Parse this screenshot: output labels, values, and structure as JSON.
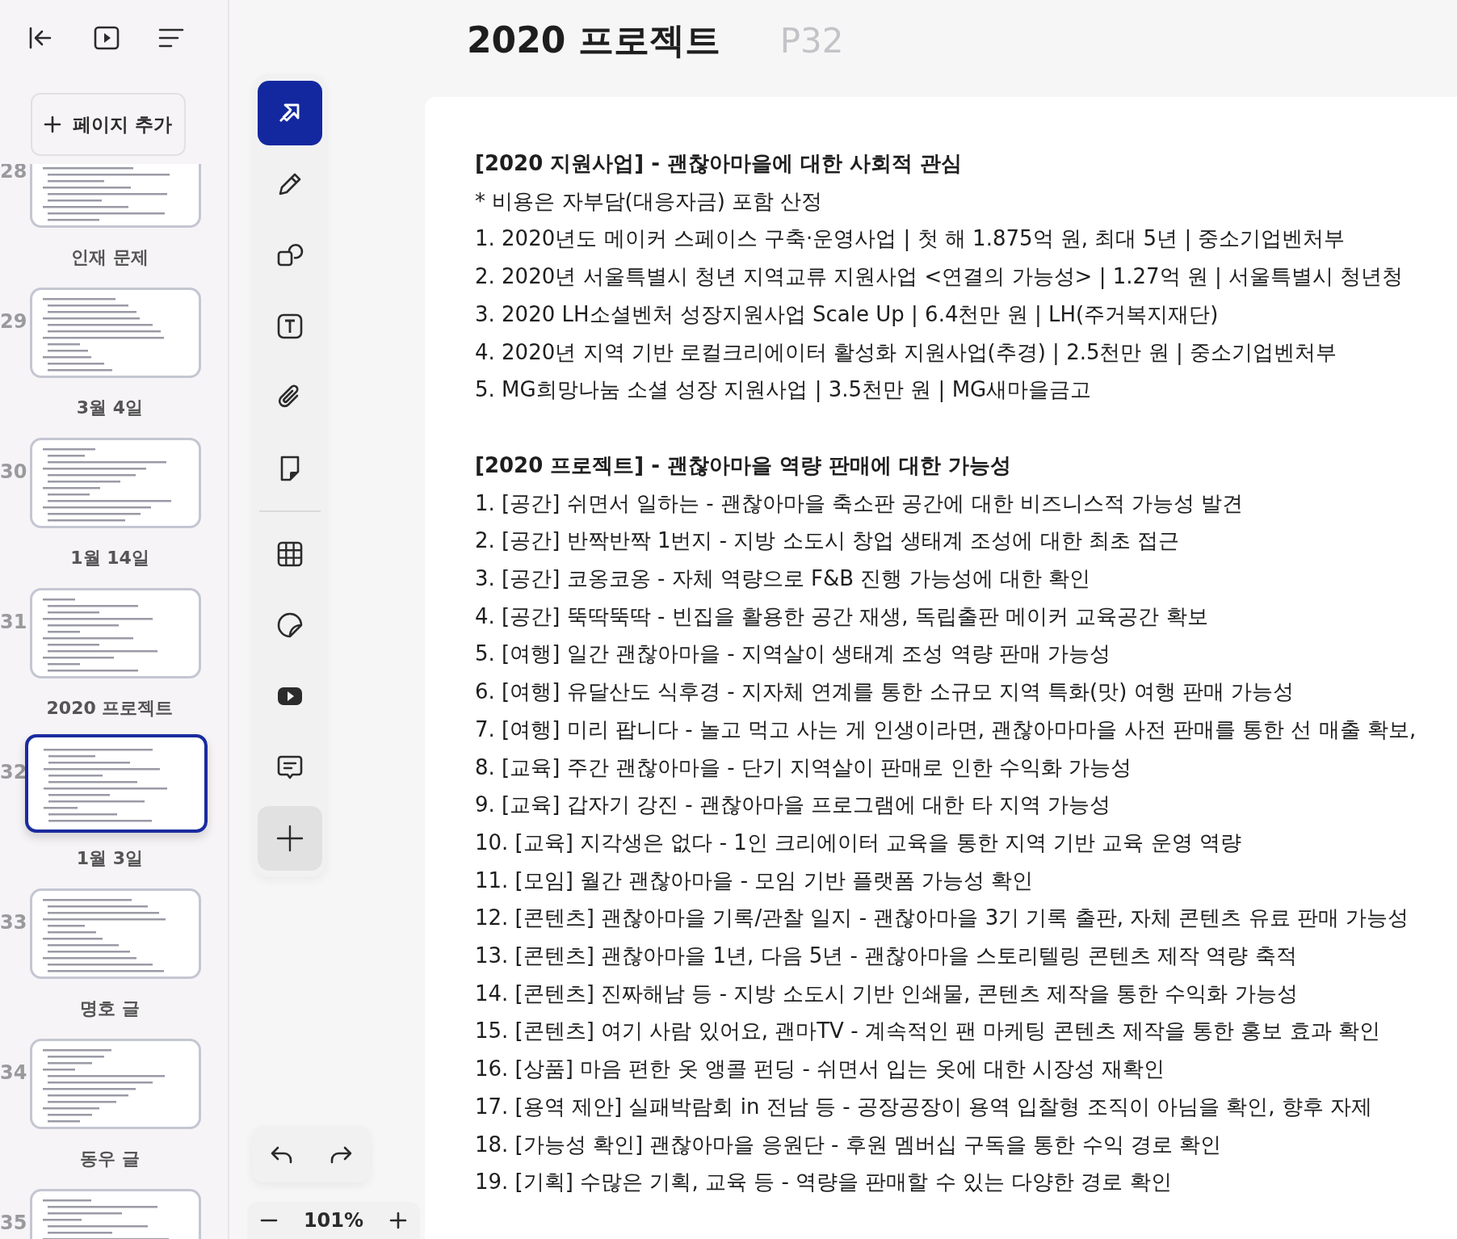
{
  "sidebar": {
    "add_page_button": {
      "label": "페이지 추가"
    },
    "pages": [
      {
        "number": "28",
        "selected": false
      },
      {
        "label": "인재 문제",
        "number": "29",
        "selected": false
      },
      {
        "label": "3월 4일",
        "number": "30",
        "selected": false
      },
      {
        "label": "1월 14일",
        "number": "31",
        "selected": false
      },
      {
        "label": "2020 프로젝트",
        "number": "32",
        "selected": true
      },
      {
        "label": "1월 3일",
        "number": "33",
        "selected": false
      },
      {
        "label": "명호 글",
        "number": "34",
        "selected": false
      },
      {
        "label": "동우 글",
        "number": "35",
        "selected": false
      }
    ]
  },
  "tools": [
    {
      "kind": "select",
      "selected": true
    },
    {
      "kind": "pen",
      "selected": false
    },
    {
      "kind": "shapes",
      "selected": false
    },
    {
      "kind": "text",
      "selected": false
    },
    {
      "kind": "attach",
      "selected": false
    },
    {
      "kind": "note",
      "selected": false
    },
    {
      "kind": "divider"
    },
    {
      "kind": "table",
      "selected": false
    },
    {
      "kind": "sticker",
      "selected": false
    },
    {
      "kind": "video",
      "selected": false
    },
    {
      "kind": "comment",
      "selected": false
    },
    {
      "kind": "add",
      "selected": false
    }
  ],
  "zoom": {
    "value": "101%"
  },
  "document": {
    "title": "2020 프로젝트",
    "page": "P32",
    "sections": [
      {
        "heading": "[2020 지원사업] - 괜찮아마을에 대한 사회적 관심",
        "lines": [
          "* 비용은 자부담(대응자금) 포함 산정",
          "1. 2020년도 메이커 스페이스 구축·운영사업 | 첫 해 1.875억 원, 최대 5년 | 중소기업벤처부",
          "2. 2020년 서울특별시 청년 지역교류 지원사업 <연결의 가능성> | 1.27억 원 | 서울특별시 청년청",
          "3. 2020 LH소셜벤처 성장지원사업 Scale Up | 6.4천만 원 | LH(주거복지재단)",
          "4. 2020년 지역 기반 로컬크리에이터 활성화 지원사업(추경) | 2.5천만 원 | 중소기업벤처부",
          "5. MG희망나눔 소셜 성장 지원사업 | 3.5천만 원 | MG새마을금고"
        ]
      },
      {
        "heading": "[2020 프로젝트] - 괜찮아마을 역량 판매에 대한 가능성",
        "lines": [
          "1. [공간] 쉬면서 일하는 - 괜찮아마을 축소판 공간에 대한 비즈니스적 가능성 발견",
          "2. [공간] 반짝반짝 1번지 - 지방 소도시 창업 생태계 조성에 대한 최초 접근",
          "3. [공간] 코옹코옹 - 자체 역량으로 F&B 진행 가능성에 대한 확인",
          "4. [공간] 뚝딱뚝딱 - 빈집을 활용한 공간 재생, 독립출판 메이커 교육공간 확보",
          "5. [여행] 일간 괜찮아마을 - 지역살이 생태계 조성 역량 판매 가능성",
          "6. [여행] 유달산도 식후경 - 지자체 연계를 통한 소규모 지역 특화(맛) 여행 판매 가능성",
          "7. [여행] 미리 팝니다 - 놀고 먹고 사는 게 인생이라면, 괜찮아마마을 사전 판매를 통한 선 매출 확보,",
          "8. [교육] 주간 괜찮아마을 - 단기 지역살이 판매로 인한 수익화 가능성",
          "9. [교육] 갑자기 강진 - 괜찮아마을 프로그램에 대한 타 지역 가능성",
          "10. [교육] 지각생은 없다 - 1인 크리에이터 교육을 통한 지역 기반 교육 운영 역량",
          "11. [모임] 월간 괜찮아마을 - 모임 기반 플랫폼 가능성 확인",
          "12. [콘텐츠] 괜찮아마을 기록/관찰 일지 - 괜찮아마을 3기 기록 출판, 자체 콘텐츠 유료 판매 가능성",
          "13. [콘텐츠] 괜찮아마을 1년, 다음 5년 - 괜찮아마을 스토리텔링 콘텐츠 제작 역량 축적",
          "14. [콘텐츠] 진짜해남 등 - 지방 소도시 기반 인쇄물, 콘텐츠 제작을 통한 수익화 가능성",
          "15. [콘텐츠] 여기 사람 있어요, 괜마TV - 계속적인 팬 마케팅 콘텐츠 제작을 통한 홍보 효과 확인",
          "16. [상품] 마음 편한 옷 앵콜 펀딩 - 쉬면서 입는 옷에 대한 시장성 재확인",
          "17. [용역 제안] 실패박람회 in 전남 등 - 공장공장이 용역 입찰형 조직이 아님을 확인, 향후 자제",
          "18. [가능성 확인] 괜찮아마을 응원단 - 후원 멤버십 구독을 통한 수익 경로 확인",
          "19. [기획] 수많은 기획, 교육 등 - 역량을 판매할 수 있는 다양한 경로 확인"
        ]
      }
    ]
  }
}
